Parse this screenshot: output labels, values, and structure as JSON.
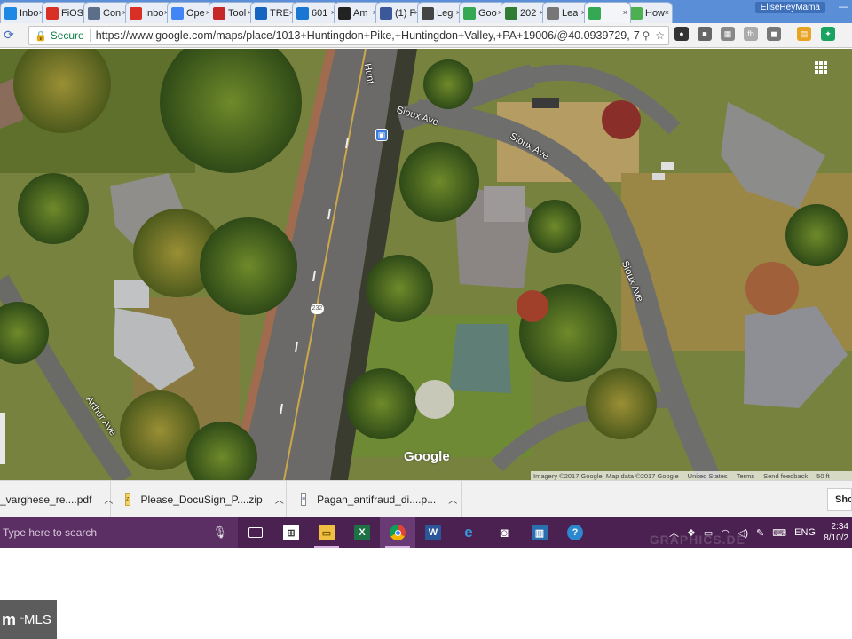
{
  "tabs": [
    {
      "label": "Inbo",
      "icon": "inbox-icon",
      "color": "#1e88e5"
    },
    {
      "label": "FiOS",
      "icon": "gmail-icon",
      "color": "#d93025"
    },
    {
      "label": "Con",
      "icon": "page-icon",
      "color": "#5b6f8a"
    },
    {
      "label": "Inbo",
      "icon": "gmail-icon",
      "color": "#d93025"
    },
    {
      "label": "Ope",
      "icon": "google-icon",
      "color": "#4285f4"
    },
    {
      "label": "Tool",
      "icon": "tool-icon",
      "color": "#c62828"
    },
    {
      "label": "TRE",
      "icon": "trend-icon",
      "color": "#1565c0"
    },
    {
      "label": "601",
      "icon": "doc-icon",
      "color": "#1976d2"
    },
    {
      "label": "Am",
      "icon": "amazon-icon",
      "color": "#222222"
    },
    {
      "label": "(1) F",
      "icon": "facebook-icon",
      "color": "#3b5998"
    },
    {
      "label": "Leg",
      "icon": "lc-icon",
      "color": "#444444"
    },
    {
      "label": "Goo",
      "icon": "maps-icon",
      "color": "#34a853"
    },
    {
      "label": "202",
      "icon": "page-icon",
      "color": "#2e7d32"
    },
    {
      "label": "Lea",
      "icon": "page-icon",
      "color": "#777777"
    },
    {
      "label": "",
      "icon": "maps-icon",
      "color": "#34a853",
      "active": true
    },
    {
      "label": "How",
      "icon": "loading-icon",
      "color": "#4caf50"
    }
  ],
  "profile_name": "EliseHeyMama",
  "address_bar": {
    "secure_label": "Secure",
    "url": "https://www.google.com/maps/place/1013+Huntingdon+Pike,+Huntingdon+Valley,+PA+19006/@40.0939729,-7"
  },
  "map": {
    "street_labels": [
      "Hunt",
      "Sioux Ave",
      "Sioux Ave",
      "Sioux Ave",
      "Arthur Ave"
    ],
    "route_shield": "232",
    "logo": "Google",
    "attribution": [
      "Imagery ©2017 Google, Map data ©2017 Google",
      "United States",
      "Terms",
      "Send feedback",
      "50 ft"
    ]
  },
  "downloads": [
    {
      "name": "_varghese_re....pdf",
      "type": "pdf"
    },
    {
      "name": "Please_DocuSign_P....zip",
      "type": "zip"
    },
    {
      "name": "Pagan_antifraud_di....p...",
      "type": "pdf"
    }
  ],
  "show_all_label": "Sho",
  "taskbar": {
    "search_placeholder": "Type here to search",
    "language": "ENG",
    "time": "2:34",
    "date": "8/10/2"
  },
  "watermark": "GRAPHICS.DE",
  "badge": {
    "brand": "MLS",
    "mark": "m",
    "tm": "™"
  }
}
